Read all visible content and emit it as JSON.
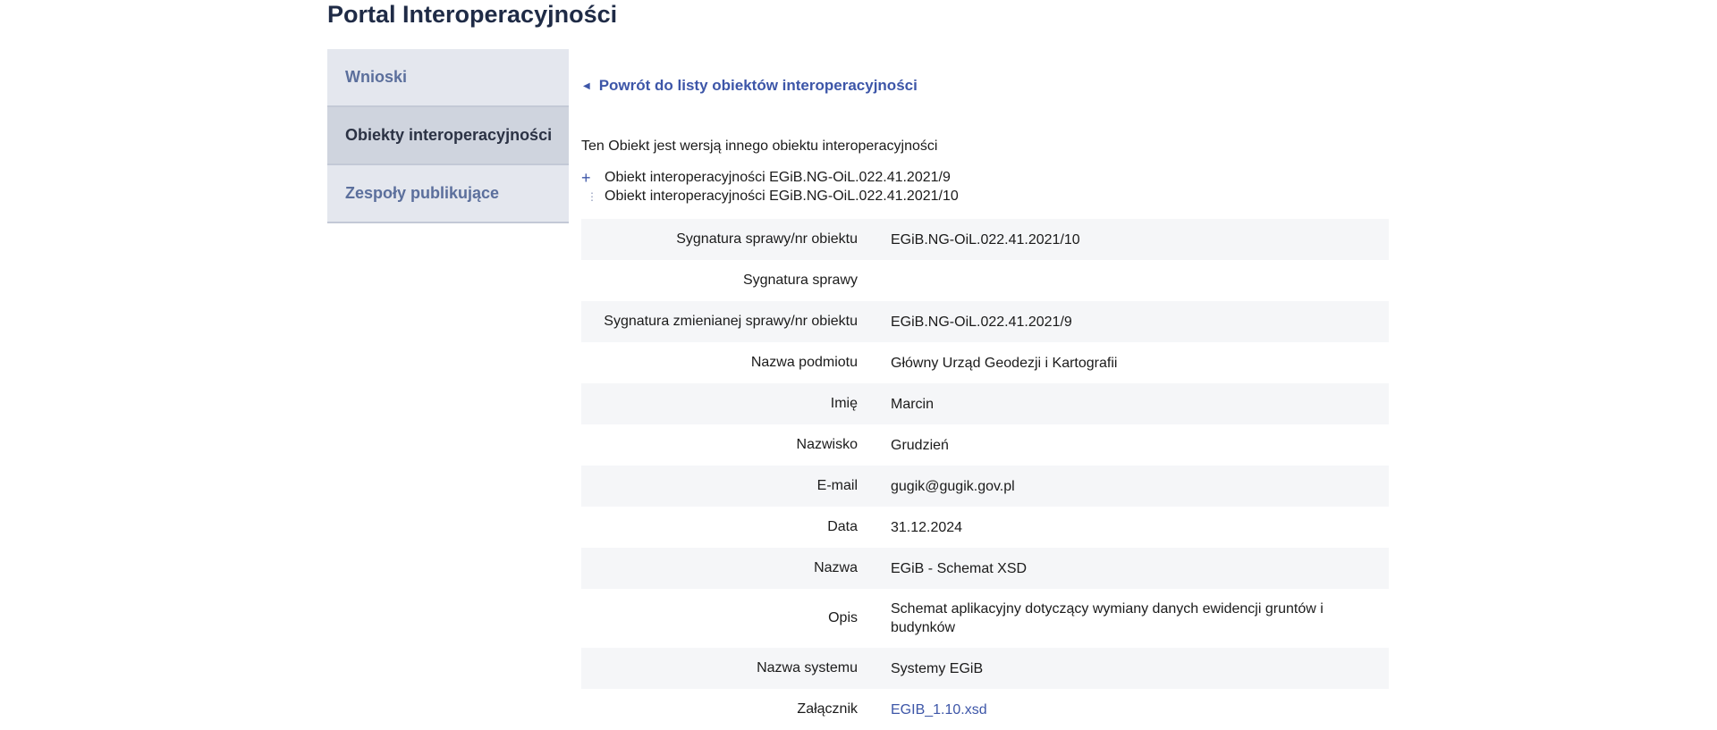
{
  "header": {
    "title": "Portal Interoperacyjności"
  },
  "sidebar": {
    "items": [
      {
        "label": "Wnioski"
      },
      {
        "label": "Obiekty interoperacyjności"
      },
      {
        "label": "Zespoły publikujące"
      }
    ]
  },
  "main": {
    "back_link": "Powrót do listy obiektów interoperacyjności",
    "intro": "Ten Obiekt jest wersją innego obiektu interoperacyjności",
    "tree": [
      {
        "label": "Obiekt interoperacyjności EGiB.NG-OiL.022.41.2021/9"
      },
      {
        "label": "Obiekt interoperacyjności EGiB.NG-OiL.022.41.2021/10"
      }
    ],
    "details": [
      {
        "label": "Sygnatura sprawy/nr obiektu",
        "value": "EGiB.NG-OiL.022.41.2021/10"
      },
      {
        "label": "Sygnatura sprawy",
        "value": ""
      },
      {
        "label": "Sygnatura zmienianej sprawy/nr obiektu",
        "value": "EGiB.NG-OiL.022.41.2021/9"
      },
      {
        "label": "Nazwa podmiotu",
        "value": "Główny Urząd Geodezji i Kartografii"
      },
      {
        "label": "Imię",
        "value": "Marcin"
      },
      {
        "label": "Nazwisko",
        "value": "Grudzień"
      },
      {
        "label": "E-mail",
        "value": "gugik@gugik.gov.pl"
      },
      {
        "label": "Data",
        "value": "31.12.2024"
      },
      {
        "label": "Nazwa",
        "value": "EGiB - Schemat XSD"
      },
      {
        "label": "Opis",
        "value": "Schemat aplikacyjny dotyczący wymiany danych ewidencji gruntów i budynków"
      },
      {
        "label": "Nazwa systemu",
        "value": "Systemy EGiB"
      },
      {
        "label": "Załącznik",
        "value": "EGIB_1.10.xsd"
      }
    ]
  },
  "icons": {
    "back": "caret-left-icon",
    "expand": "plus-icon",
    "tree_branch": "tree-branch-icon"
  },
  "colors": {
    "link": "#3d56a8",
    "title": "#1f2b46",
    "sidebar_bg": "#e4e7ee",
    "sidebar_active_bg": "#cfd4de",
    "row_alt": "#f5f6f8"
  }
}
